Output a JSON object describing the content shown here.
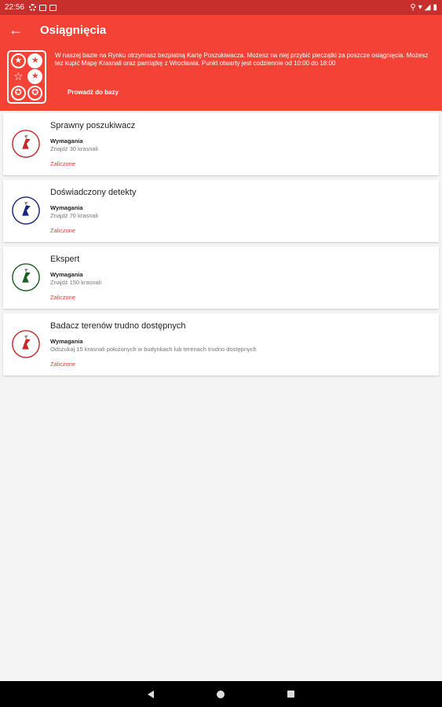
{
  "status_bar": {
    "time": "22:56"
  },
  "app_bar": {
    "title": "Osiągnięcia",
    "back_icon": "arrow-back-icon"
  },
  "banner": {
    "text": "W naszej bazie na Rynku otrzymasz bezpłatną Kartę Poszukiwacza. Możesz na niej przybić pieczątki za poszcze osiągnięcia. Możesz tez kupić Mapę Krasnali oraz pamiątkę z Wrocławia. Punkt otwarty jest codziennie od 10:00 do 18:00",
    "button_label": "Prowadź do bazy",
    "card_icon": "stamp-card-icon"
  },
  "achievements": [
    {
      "name": "Sprawny poszukiwacz",
      "req_label": "Wymagania",
      "req_text": "Znajdź 30 krasnali",
      "status": "Zaliczone",
      "color": "#c62828"
    },
    {
      "name": "Doświadczony detekty",
      "req_label": "Wymagania",
      "req_text": "Znajdź 70 krasnali",
      "status": "Zaliczone",
      "color": "#1a237e"
    },
    {
      "name": "Ekspert",
      "req_label": "Wymagania",
      "req_text": "Znajdź 150 krasnali",
      "status": "Zaliczone",
      "color": "#1b5e20"
    },
    {
      "name": "Badacz terenów trudno dostępnych",
      "req_label": "Wymagania",
      "req_text": "Odszukaj 15 krasnali położonych w budynkach lub terenach trudno dostępnych",
      "status": "Zaliczone",
      "color": "#c62828"
    }
  ],
  "nav_bar": {
    "back": "nav-back-icon",
    "home": "nav-home-icon",
    "recents": "nav-recents-icon"
  }
}
